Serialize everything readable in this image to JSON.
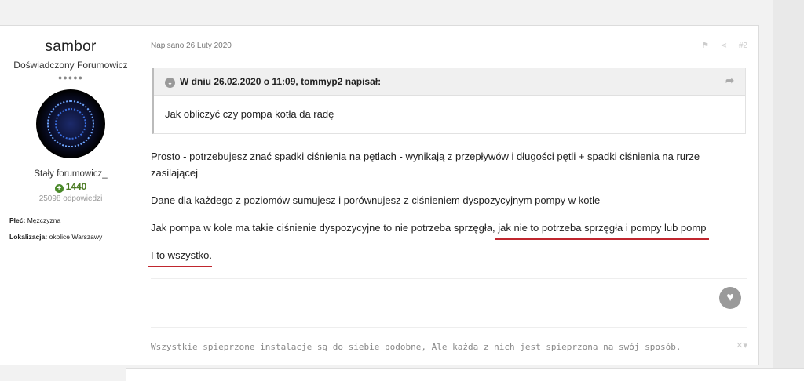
{
  "author": {
    "name": "sambor",
    "rank": "Doświadczony Forumowicz",
    "pips": "●●●●●",
    "member_title": "Stały forumowicz_",
    "reputation": "1440",
    "replies": "25098 odpowiedzi",
    "gender_label": "Płeć:",
    "gender_value": "Mężczyzna",
    "location_label": "Lokalizacja:",
    "location_value": "okolice Warszawy"
  },
  "post": {
    "date": "Napisano 26 Luty 2020",
    "report_icon": "flag-icon",
    "share_icon": "share-icon",
    "number": "#2",
    "quote_header": "W dniu 26.02.2020 o 11:09, tommyp2 napisał:",
    "quote_text": "Jak obliczyć czy pompa kotła da radę",
    "paragraphs": {
      "p1": "Prosto - potrzebujesz znać spadki ciśnienia na pętlach - wynikają z przepływów i długości pętli + spadki ciśnienia na rurze zasilającej",
      "p2": "Dane dla każdego z poziomów sumujesz i porównujesz z ciśnieniem dyspozycyjnym pompy w kotle",
      "p3a": "Jak pompa w kole ma takie ciśnienie dyspozycyjne to nie potrzeba sprzęgła, ",
      "p3b": "jak nie to potrzeba sprzęgła i pompy lub pomp",
      "p4": "I to wszystko",
      "p4_end": "."
    },
    "signature": "Wszystkie spieprzone instalacje są do siebie podobne, Ale każda z nich jest spieprzona na swój sposób."
  },
  "colors": {
    "underline": "#c0262e",
    "reputation": "#4a7a22"
  }
}
